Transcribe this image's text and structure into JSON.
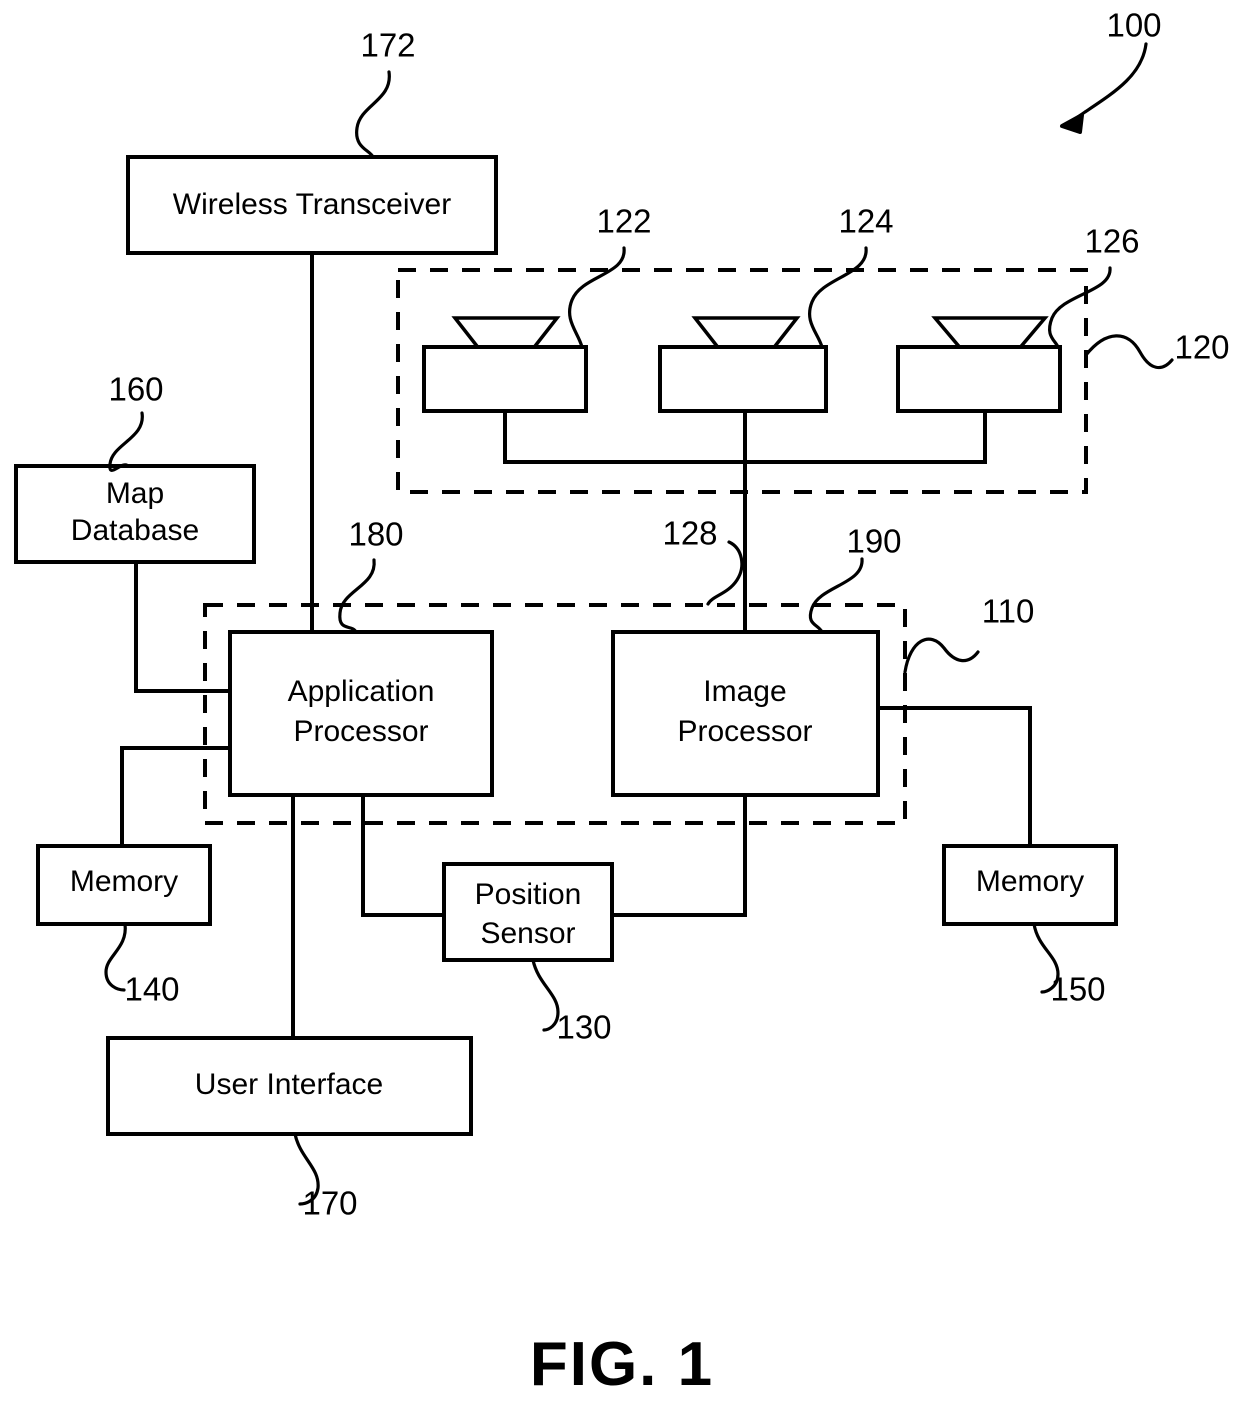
{
  "figure": {
    "caption": "FIG. 1",
    "system_ref": "100"
  },
  "blocks": [
    {
      "id": "wireless-transceiver",
      "label": "Wireless Transceiver",
      "ref": "172"
    },
    {
      "id": "map-database",
      "label_line1": "Map",
      "label_line2": "Database",
      "ref": "160"
    },
    {
      "id": "application-processor",
      "label_line1": "Application",
      "label_line2": "Processor",
      "ref": "180"
    },
    {
      "id": "image-processor",
      "label_line1": "Image",
      "label_line2": "Processor",
      "ref": "190"
    },
    {
      "id": "memory-left",
      "label": "Memory",
      "ref": "140"
    },
    {
      "id": "memory-right",
      "label": "Memory",
      "ref": "150"
    },
    {
      "id": "position-sensor",
      "label_line1": "Position",
      "label_line2": "Sensor",
      "ref": "130"
    },
    {
      "id": "user-interface",
      "label": "User Interface",
      "ref": "170"
    }
  ],
  "cameras": {
    "group_ref": "120",
    "bus_ref": "128",
    "units": [
      {
        "id": "camera-1",
        "ref": "122"
      },
      {
        "id": "camera-2",
        "ref": "124"
      },
      {
        "id": "camera-3",
        "ref": "126"
      }
    ]
  },
  "processing_unit": {
    "ref": "110"
  },
  "labels": {
    "wireless_transceiver": "Wireless Transceiver",
    "map_database_l1": "Map",
    "map_database_l2": "Database",
    "application_processor_l1": "Application",
    "application_processor_l2": "Processor",
    "image_processor_l1": "Image",
    "image_processor_l2": "Processor",
    "memory_left": "Memory",
    "memory_right": "Memory",
    "position_sensor_l1": "Position",
    "position_sensor_l2": "Sensor",
    "user_interface": "User Interface"
  },
  "refs": {
    "system": "100",
    "processing_unit": "110",
    "camera_group": "120",
    "camera_1": "122",
    "camera_2": "124",
    "camera_3": "126",
    "camera_bus": "128",
    "position_sensor": "130",
    "memory_left": "140",
    "memory_right": "150",
    "map_database": "160",
    "user_interface": "170",
    "wireless_transceiver": "172",
    "application_processor": "180",
    "image_processor": "190"
  },
  "style": {
    "ink": "#000000",
    "paper": "#ffffff"
  }
}
